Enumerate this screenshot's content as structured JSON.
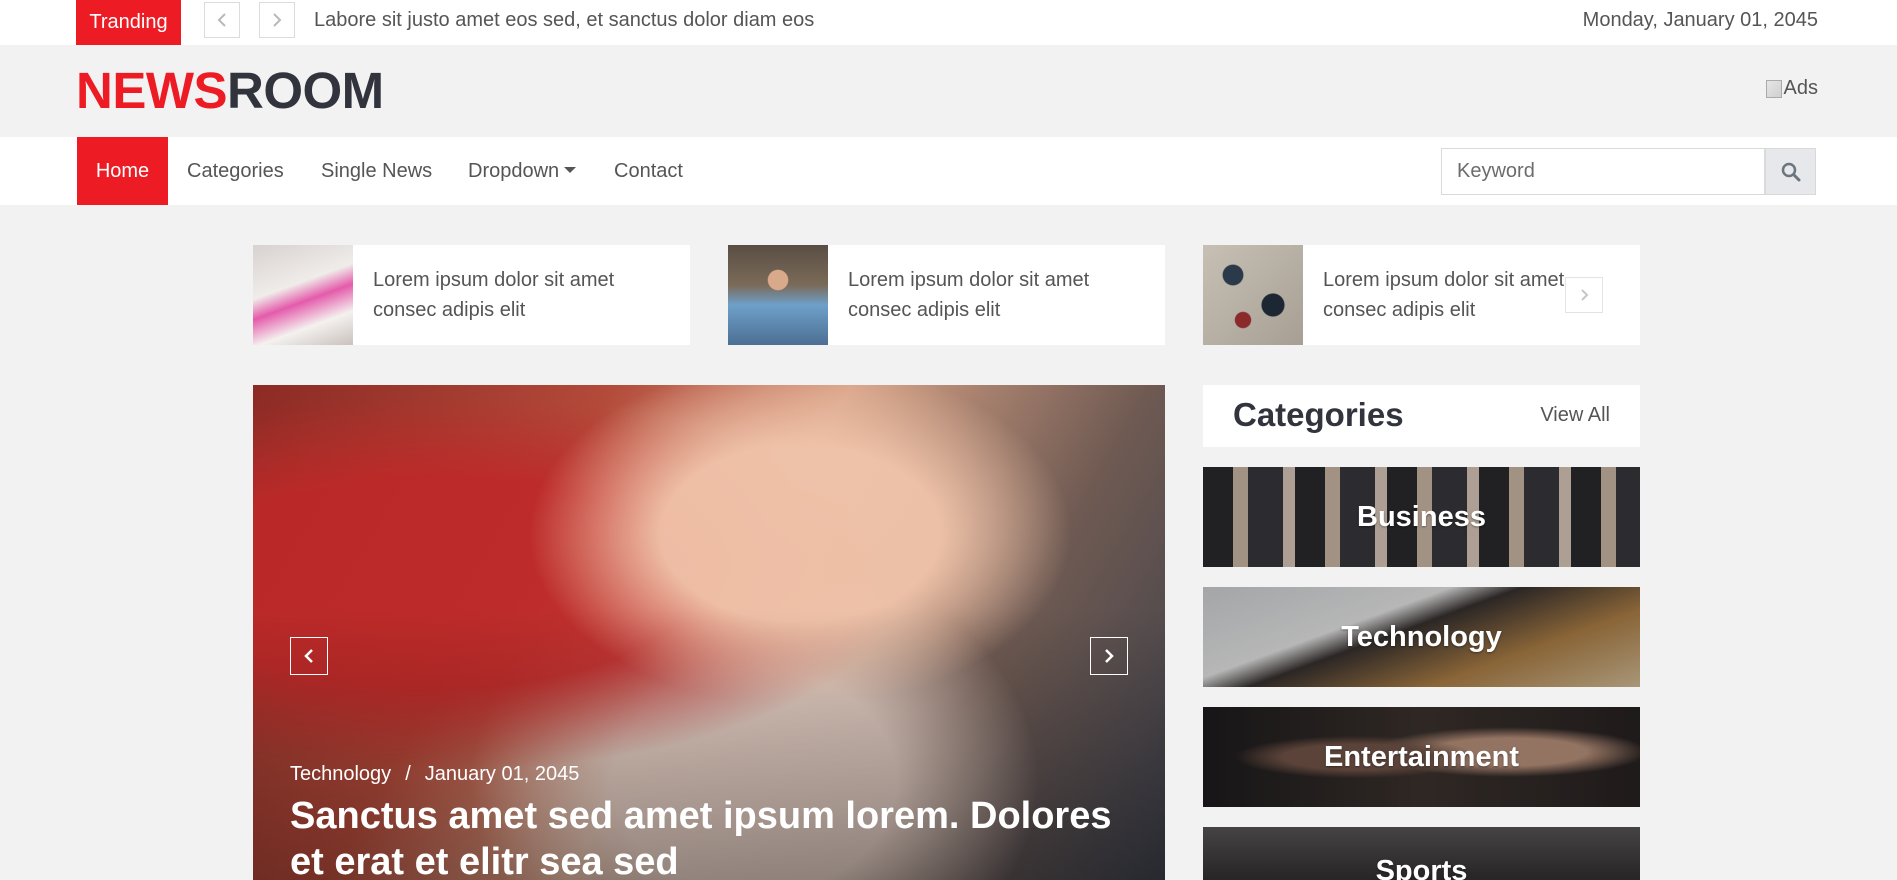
{
  "topbar": {
    "trending_label": "Tranding",
    "trending_text": "Labore sit justo amet eos sed, et sanctus dolor diam eos",
    "date": "Monday, January 01, 2045",
    "prev_icon": "chevron-left-icon",
    "next_icon": "chevron-right-icon"
  },
  "brand": {
    "logo_part1": "NEWS",
    "logo_part2": "ROOM",
    "ads_alt": "Ads",
    "accent_color": "#ed1c24",
    "dark_color": "#31333d"
  },
  "nav": {
    "items": [
      {
        "label": "Home",
        "active": true
      },
      {
        "label": "Categories"
      },
      {
        "label": "Single News"
      },
      {
        "label": "Dropdown"
      },
      {
        "label": "Contact"
      }
    ],
    "search_placeholder": "Keyword",
    "search_icon": "search-icon"
  },
  "mini_news": [
    {
      "title": "Lorem ipsum dolor sit amet consec adipis elit"
    },
    {
      "title": "Lorem ipsum dolor sit amet consec adipis elit"
    },
    {
      "title": "Lorem ipsum dolor sit amet consec adipis elit"
    }
  ],
  "hero": {
    "category": "Technology",
    "separator": "/",
    "date": "January 01, 2045",
    "title": "Sanctus amet sed amet ipsum lorem. Dolores et erat et elitr sea sed"
  },
  "categories": {
    "title": "Categories",
    "view_all": "View All",
    "items": [
      {
        "label": "Business"
      },
      {
        "label": "Technology"
      },
      {
        "label": "Entertainment"
      },
      {
        "label": "Sports"
      }
    ]
  }
}
